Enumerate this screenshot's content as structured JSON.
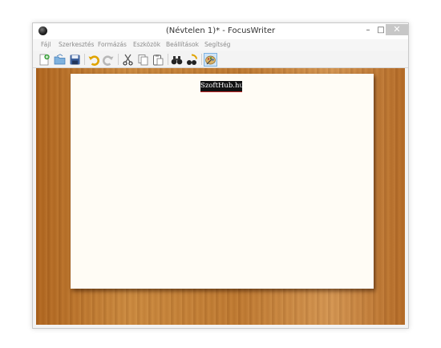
{
  "window": {
    "title": "(Névtelen 1)* - FocusWriter",
    "controls": {
      "minimize": "–",
      "maximize": "□",
      "close": "✕"
    }
  },
  "menu": {
    "items": [
      "Fájl",
      "Szerkesztés",
      "Formázás",
      "Eszközök",
      "Beállítások",
      "Segítség"
    ]
  },
  "toolbar": {
    "buttons": [
      {
        "icon": "new-document-icon"
      },
      {
        "icon": "open-folder-icon"
      },
      {
        "icon": "save-icon"
      },
      {
        "icon": "undo-icon"
      },
      {
        "icon": "redo-icon"
      },
      {
        "icon": "cut-icon"
      },
      {
        "icon": "copy-icon"
      },
      {
        "icon": "paste-icon"
      },
      {
        "icon": "find-binoculars-icon"
      },
      {
        "icon": "replace-icon"
      },
      {
        "icon": "themes-icon",
        "active": true
      }
    ]
  },
  "document": {
    "watermark": "SzoftHub.hu"
  },
  "colors": {
    "paper": "#fffcf5",
    "wood": "#c07a31",
    "menu_text": "#8c8c8c",
    "active_tool": "#cfe4f7"
  }
}
